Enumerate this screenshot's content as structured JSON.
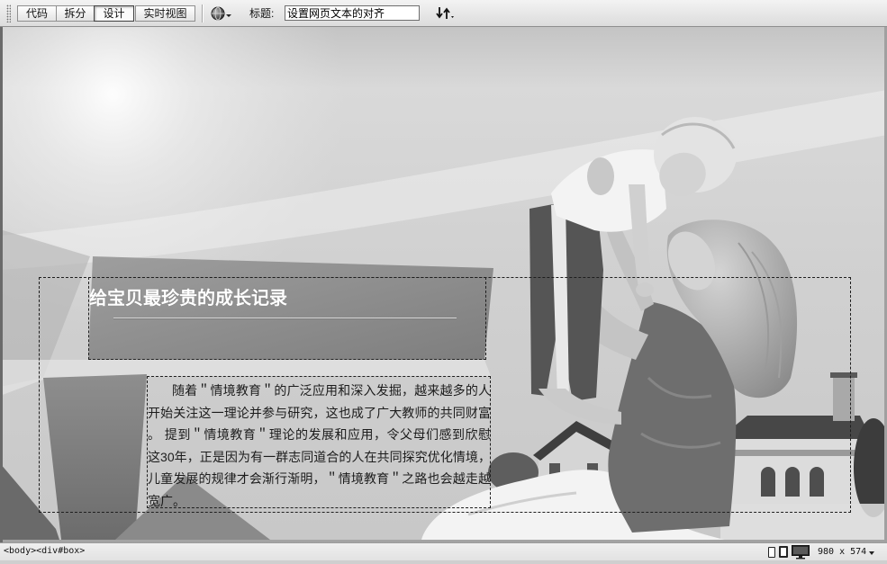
{
  "toolbar": {
    "view_buttons": [
      {
        "label": "代码",
        "active": false
      },
      {
        "label": "拆分",
        "active": false
      },
      {
        "label": "设计",
        "active": true
      },
      {
        "label": "实时视图",
        "active": false
      }
    ],
    "title_label": "标题:",
    "title_value": "设置网页文本的对齐",
    "icons": {
      "grip": "toolbar-grip",
      "globe": "globe-icon",
      "file_management": "file-management-icon"
    }
  },
  "design_view": {
    "heading": "给宝贝最珍贵的成长记录",
    "paragraph_lines": [
      "随着＂情境教育＂的广泛应用和深入发掘，越来越多的人",
      "开始关注这一理论并参与研究，这也成了广大教师的共同财富",
      "。 提到＂情境教育＂理论的发展和应用，令父母们感到欣慰",
      "这30年，正是因为有一群志同道合的人在共同探究优化情境，",
      "儿童发展的规律才会渐行渐明，＂情境教育＂之路也会越走越",
      "宽广。"
    ]
  },
  "status_bar": {
    "tag_selector": [
      "<body>",
      "<div#box>"
    ],
    "window_size": "980 x 574",
    "icons": {
      "mobile": "mobile-size-icon",
      "tablet": "tablet-size-icon",
      "desktop": "desktop-size-icon",
      "size_menu": "chevron-down-icon"
    }
  },
  "colors": {
    "toolbar_bg": "#e6e6e6",
    "box_border": "#1e1e1e",
    "heading_text": "#ffffff",
    "paragraph_text": "#1c1c1c"
  }
}
